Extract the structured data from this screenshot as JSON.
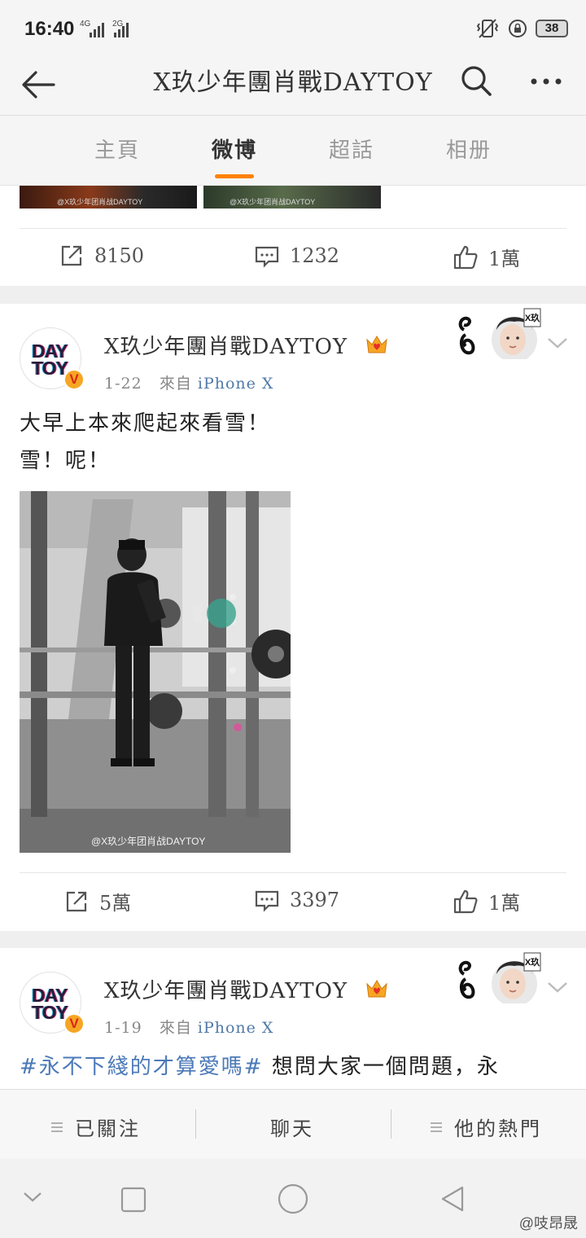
{
  "status_bar": {
    "time": "16:40",
    "signal_1": "4G",
    "signal_2": "2G",
    "battery": "38"
  },
  "nav": {
    "title": "X玖少年團肖戰DAYTOY"
  },
  "tabs": [
    {
      "label": "主頁",
      "active": false
    },
    {
      "label": "微博",
      "active": true
    },
    {
      "label": "超話",
      "active": false
    },
    {
      "label": "相册",
      "active": false
    }
  ],
  "prev_card": {
    "thumb_watermark_1": "@X玖少年团肖战DAYTOY",
    "thumb_watermark_2": "@X玖少年团肖战DAYTOY",
    "reposts": "8150",
    "comments": "1232",
    "likes": "1萬"
  },
  "posts": [
    {
      "avatar_line1": "DAY",
      "avatar_line2": "TOY",
      "username": "X玖少年團肖戰DAYTOY",
      "date": "1-22",
      "source_prefix": "來自",
      "source": "iPhone X",
      "text_line1": "大早上本來爬起來看雪！",
      "text_line2": "雪！呢！",
      "image_watermark": "@X玖少年团肖战DAYTOY",
      "reposts": "5萬",
      "comments": "3397",
      "likes": "1萬"
    },
    {
      "avatar_line1": "DAY",
      "avatar_line2": "TOY",
      "username": "X玖少年團肖戰DAYTOY",
      "date": "1-19",
      "source_prefix": "來自",
      "source": "iPhone X",
      "topic": "#永不下綫的才算愛嗎#",
      "text_line1": " 想問大家一個問題，永"
    }
  ],
  "deco_badge": "X玖",
  "bottom_bar": {
    "follow": "已關注",
    "chat": "聊天",
    "hot": "他的熱門"
  },
  "watermark": "@吱昂晟",
  "colors": {
    "accent": "#ff8200",
    "link": "#5079a8",
    "topic": "#4c7ab8",
    "vip_badge": "#f6a623"
  }
}
